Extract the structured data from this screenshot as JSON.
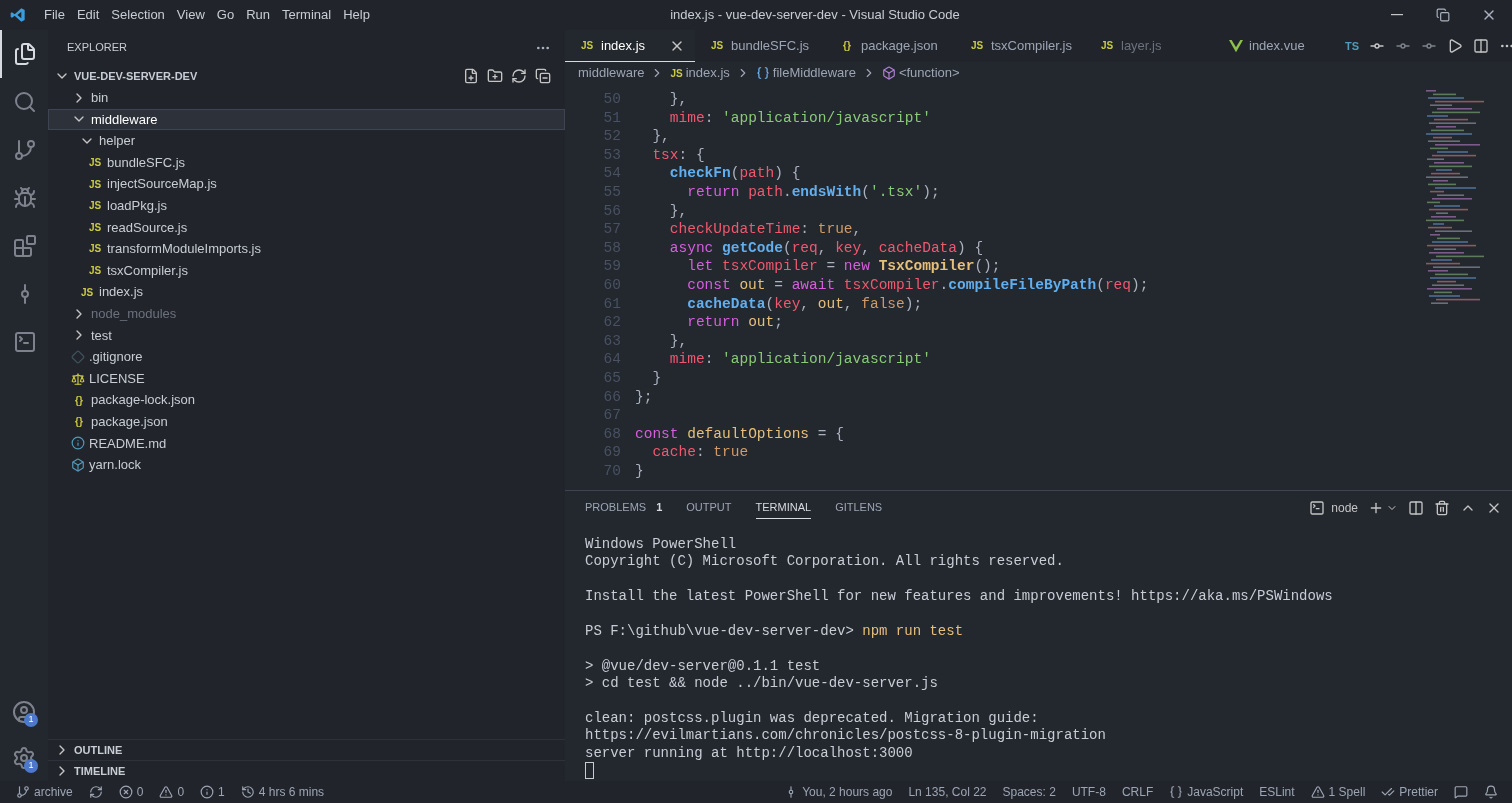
{
  "window": {
    "title": "index.js - vue-dev-server-dev - Visual Studio Code"
  },
  "menu": [
    "File",
    "Edit",
    "Selection",
    "View",
    "Go",
    "Run",
    "Terminal",
    "Help"
  ],
  "activity_bar": [
    {
      "kind": "explorer",
      "selected": true
    },
    {
      "kind": "search",
      "selected": false
    },
    {
      "kind": "source-control",
      "selected": false
    },
    {
      "kind": "run",
      "selected": false
    },
    {
      "kind": "extensions",
      "selected": false
    },
    {
      "kind": "gitlens",
      "selected": false
    },
    {
      "kind": "terminal",
      "selected": false
    }
  ],
  "activity_bottom": [
    {
      "kind": "account",
      "badge": "1"
    },
    {
      "kind": "settings",
      "badge": "1"
    }
  ],
  "sidebar": {
    "title": "EXPLORER",
    "root": "VUE-DEV-SERVER-DEV",
    "tree": [
      {
        "label": "bin",
        "kind": "folder",
        "expanded": false,
        "selected": false,
        "dimmed": false
      },
      {
        "label": "middleware",
        "kind": "folder",
        "expanded": true,
        "selected": true,
        "dimmed": false,
        "children": [
          {
            "label": "helper",
            "kind": "folder",
            "expanded": true,
            "selected": false,
            "dimmed": false,
            "children": [
              {
                "label": "bundleSFC.js",
                "kind": "js",
                "glyph": "JS",
                "selected": false,
                "dimmed": false
              },
              {
                "label": "injectSourceMap.js",
                "kind": "js",
                "glyph": "JS",
                "selected": false,
                "dimmed": false
              },
              {
                "label": "loadPkg.js",
                "kind": "js",
                "glyph": "JS",
                "selected": false,
                "dimmed": false
              },
              {
                "label": "readSource.js",
                "kind": "js",
                "glyph": "JS",
                "selected": false,
                "dimmed": false
              },
              {
                "label": "transformModuleImports.js",
                "kind": "js",
                "glyph": "JS",
                "selected": false,
                "dimmed": false
              },
              {
                "label": "tsxCompiler.js",
                "kind": "js",
                "glyph": "JS",
                "selected": false,
                "dimmed": false
              }
            ]
          },
          {
            "label": "index.js",
            "kind": "js",
            "glyph": "JS",
            "selected": false,
            "dimmed": false
          }
        ]
      },
      {
        "label": "node_modules",
        "kind": "folder",
        "expanded": false,
        "selected": false,
        "dimmed": true
      },
      {
        "label": "test",
        "kind": "folder",
        "expanded": false,
        "selected": false,
        "dimmed": false
      },
      {
        "label": ".gitignore",
        "kind": "git",
        "selected": false,
        "dimmed": false
      },
      {
        "label": "LICENSE",
        "kind": "license",
        "selected": false,
        "dimmed": false
      },
      {
        "label": "package-lock.json",
        "kind": "json",
        "glyph": "{}",
        "selected": false,
        "dimmed": false
      },
      {
        "label": "package.json",
        "kind": "json",
        "glyph": "{}",
        "selected": false,
        "dimmed": false
      },
      {
        "label": "README.md",
        "kind": "info",
        "selected": false,
        "dimmed": false
      },
      {
        "label": "yarn.lock",
        "kind": "yarn",
        "selected": false,
        "dimmed": false
      }
    ],
    "sections": [
      "OUTLINE",
      "TIMELINE"
    ]
  },
  "tabs": [
    {
      "label": "index.js",
      "kind": "js",
      "glyph": "JS",
      "selected": true,
      "dimmed": false
    },
    {
      "label": "bundleSFC.js",
      "kind": "js",
      "glyph": "JS",
      "selected": false,
      "dimmed": false
    },
    {
      "label": "package.json",
      "kind": "json",
      "glyph": "{}",
      "selected": false,
      "dimmed": false
    },
    {
      "label": "tsxCompiler.js",
      "kind": "js",
      "glyph": "JS",
      "selected": false,
      "dimmed": false
    },
    {
      "label": "layer.js",
      "kind": "js",
      "glyph": "JS",
      "selected": false,
      "dimmed": true
    },
    {
      "label": "index.vue",
      "kind": "vue",
      "selected": false,
      "dimmed": false
    }
  ],
  "editor_actions_label": "TS",
  "breadcrumb": [
    {
      "label": "middleware",
      "kind": "folder"
    },
    {
      "label": "index.js",
      "kind": "js",
      "glyph": "JS"
    },
    {
      "label": "fileMiddleware",
      "kind": "variable"
    },
    {
      "label": "<function>",
      "kind": "function"
    }
  ],
  "code": [
    {
      "n": "50",
      "tokens": [
        {
          "text": "    },",
          "kind": "p"
        }
      ]
    },
    {
      "n": "51",
      "tokens": [
        {
          "text": "    mime",
          "kind": "prop"
        },
        {
          "text": ": ",
          "kind": "p"
        },
        {
          "text": "'application/javascript'",
          "kind": "str"
        }
      ]
    },
    {
      "n": "52",
      "tokens": [
        {
          "text": "  },",
          "kind": "p"
        }
      ]
    },
    {
      "n": "53",
      "tokens": [
        {
          "text": "  tsx",
          "kind": "prop"
        },
        {
          "text": ": {",
          "kind": "p"
        }
      ]
    },
    {
      "n": "54",
      "tokens": [
        {
          "text": "    checkFn",
          "kind": "fn"
        },
        {
          "text": "(",
          "kind": "p"
        },
        {
          "text": "path",
          "kind": "var"
        },
        {
          "text": ") {",
          "kind": "p"
        }
      ]
    },
    {
      "n": "55",
      "tokens": [
        {
          "text": "      return ",
          "kind": "kw"
        },
        {
          "text": "path",
          "kind": "var"
        },
        {
          "text": ".",
          "kind": "p"
        },
        {
          "text": "endsWith",
          "kind": "fn"
        },
        {
          "text": "(",
          "kind": "p"
        },
        {
          "text": "'.tsx'",
          "kind": "str"
        },
        {
          "text": ");",
          "kind": "p"
        }
      ]
    },
    {
      "n": "56",
      "tokens": [
        {
          "text": "    },",
          "kind": "p"
        }
      ]
    },
    {
      "n": "57",
      "tokens": [
        {
          "text": "    checkUpdateTime",
          "kind": "prop"
        },
        {
          "text": ": ",
          "kind": "p"
        },
        {
          "text": "true",
          "kind": "num"
        },
        {
          "text": ",",
          "kind": "p"
        }
      ]
    },
    {
      "n": "58",
      "tokens": [
        {
          "text": "    async ",
          "kind": "kw"
        },
        {
          "text": "getCode",
          "kind": "fn"
        },
        {
          "text": "(",
          "kind": "p"
        },
        {
          "text": "req",
          "kind": "var"
        },
        {
          "text": ", ",
          "kind": "p"
        },
        {
          "text": "key",
          "kind": "var"
        },
        {
          "text": ", ",
          "kind": "p"
        },
        {
          "text": "cacheData",
          "kind": "var"
        },
        {
          "text": ") {",
          "kind": "p"
        }
      ]
    },
    {
      "n": "59",
      "tokens": [
        {
          "text": "      let ",
          "kind": "kw"
        },
        {
          "text": "tsxCompiler",
          "kind": "var"
        },
        {
          "text": " = ",
          "kind": "p"
        },
        {
          "text": "new ",
          "kind": "kw"
        },
        {
          "text": "TsxCompiler",
          "kind": "cls"
        },
        {
          "text": "();",
          "kind": "p"
        }
      ]
    },
    {
      "n": "60",
      "tokens": [
        {
          "text": "      const ",
          "kind": "kw"
        },
        {
          "text": "out",
          "kind": "id"
        },
        {
          "text": " = ",
          "kind": "p"
        },
        {
          "text": "await ",
          "kind": "kw"
        },
        {
          "text": "tsxCompiler",
          "kind": "var"
        },
        {
          "text": ".",
          "kind": "p"
        },
        {
          "text": "compileFileByPath",
          "kind": "fn"
        },
        {
          "text": "(",
          "kind": "p"
        },
        {
          "text": "req",
          "kind": "var"
        },
        {
          "text": ");",
          "kind": "p"
        }
      ]
    },
    {
      "n": "61",
      "tokens": [
        {
          "text": "      cacheData",
          "kind": "fn"
        },
        {
          "text": "(",
          "kind": "p"
        },
        {
          "text": "key",
          "kind": "var"
        },
        {
          "text": ", ",
          "kind": "p"
        },
        {
          "text": "out",
          "kind": "id"
        },
        {
          "text": ", ",
          "kind": "p"
        },
        {
          "text": "false",
          "kind": "num"
        },
        {
          "text": ");",
          "kind": "p"
        }
      ]
    },
    {
      "n": "62",
      "tokens": [
        {
          "text": "      return ",
          "kind": "kw"
        },
        {
          "text": "out",
          "kind": "id"
        },
        {
          "text": ";",
          "kind": "p"
        }
      ]
    },
    {
      "n": "63",
      "tokens": [
        {
          "text": "    },",
          "kind": "p"
        }
      ]
    },
    {
      "n": "64",
      "tokens": [
        {
          "text": "    mime",
          "kind": "prop"
        },
        {
          "text": ": ",
          "kind": "p"
        },
        {
          "text": "'application/javascript'",
          "kind": "str"
        }
      ]
    },
    {
      "n": "65",
      "tokens": [
        {
          "text": "  }",
          "kind": "p"
        }
      ]
    },
    {
      "n": "66",
      "tokens": [
        {
          "text": "};",
          "kind": "p"
        }
      ]
    },
    {
      "n": "67"
    },
    {
      "n": "68",
      "tokens": [
        {
          "text": "const ",
          "kind": "kw"
        },
        {
          "text": "defaultOptions",
          "kind": "id"
        },
        {
          "text": " = {",
          "kind": "p"
        }
      ]
    },
    {
      "n": "69",
      "tokens": [
        {
          "text": "  cache",
          "kind": "prop"
        },
        {
          "text": ": ",
          "kind": "p"
        },
        {
          "text": "true",
          "kind": "num"
        }
      ]
    },
    {
      "n": "70",
      "tokens": [
        {
          "text": "}",
          "kind": "p"
        }
      ]
    }
  ],
  "panel": {
    "tabs": [
      {
        "label": "PROBLEMS",
        "badge": "1",
        "selected": false
      },
      {
        "label": "OUTPUT",
        "selected": false
      },
      {
        "label": "TERMINAL",
        "selected": true
      },
      {
        "label": "GITLENS",
        "selected": false
      }
    ],
    "terminal_name": "node",
    "blocks": [
      [
        [
          {
            "text": "Windows PowerShell",
            "kind": "plain"
          }
        ],
        [
          {
            "text": "Copyright (C) Microsoft Corporation. All rights reserved.",
            "kind": "plain"
          }
        ]
      ],
      [
        [
          {
            "text": "Install the latest PowerShell for new features and improvements! https://aka.ms/PSWindows",
            "kind": "plain"
          }
        ]
      ],
      [
        [
          {
            "text": "PS F:\\github\\vue-dev-server-dev>",
            "kind": "plain"
          },
          {
            "text": "npm run test",
            "kind": "command"
          }
        ]
      ],
      [
        [
          {
            "text": "> @vue/dev-server@0.1.1 test",
            "kind": "plain"
          }
        ],
        [
          {
            "text": "> cd test && node ../bin/vue-dev-server.js",
            "kind": "plain"
          }
        ]
      ],
      [
        [
          {
            "text": "clean: postcss.plugin was deprecated. Migration guide:",
            "kind": "plain"
          }
        ],
        [
          {
            "text": "https://evilmartians.com/chronicles/postcss-8-plugin-migration",
            "kind": "plain"
          }
        ],
        [
          {
            "text": "server running at http://localhost:3000",
            "kind": "plain"
          }
        ]
      ]
    ]
  },
  "status_bar": {
    "left": [
      {
        "kind": "branch",
        "text": "archive"
      },
      {
        "kind": "sync"
      },
      {
        "kind": "errors",
        "text": "0"
      },
      {
        "kind": "warnings",
        "text": "0"
      },
      {
        "kind": "infos",
        "text": "1"
      },
      {
        "kind": "time",
        "text": "4 hrs 6 mins"
      }
    ],
    "right": [
      {
        "kind": "blame",
        "text": "You, 2 hours ago"
      },
      {
        "kind": "text",
        "text": "Ln 135, Col 22"
      },
      {
        "kind": "text",
        "text": "Spaces: 2"
      },
      {
        "kind": "text",
        "text": "UTF-8"
      },
      {
        "kind": "text",
        "text": "CRLF"
      },
      {
        "kind": "language",
        "text": "JavaScript"
      },
      {
        "kind": "text",
        "text": "ESLint"
      },
      {
        "kind": "spell",
        "text": "1 Spell"
      },
      {
        "kind": "prettier",
        "text": "Prettier"
      },
      {
        "kind": "feedback"
      },
      {
        "kind": "bell"
      }
    ]
  }
}
